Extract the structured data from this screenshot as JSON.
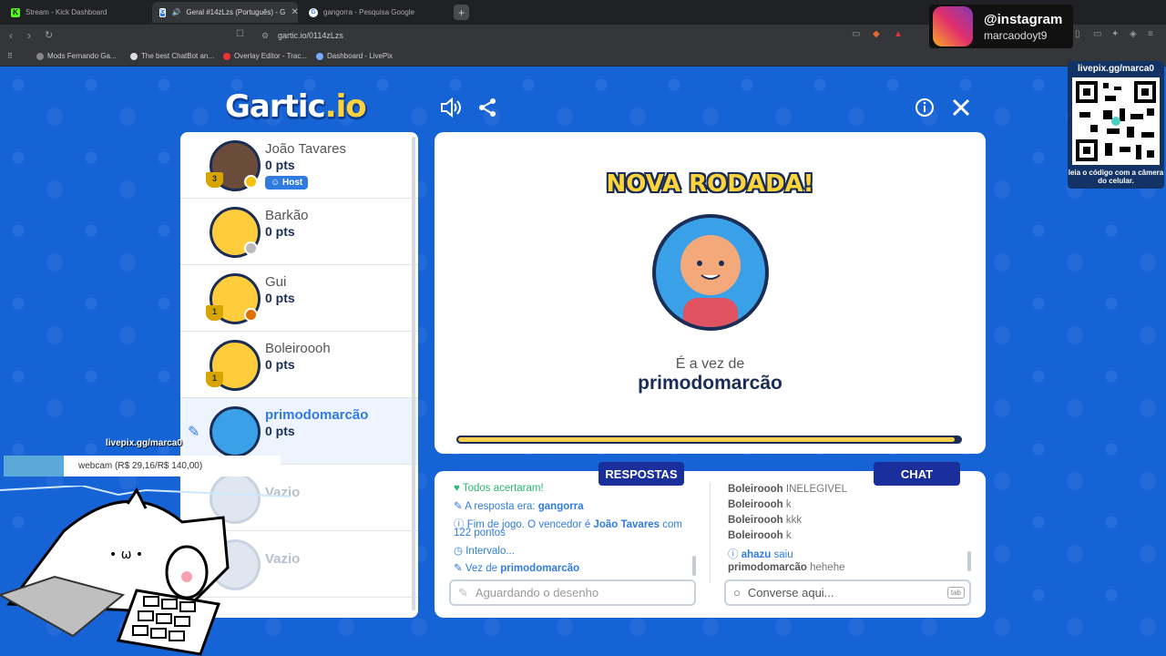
{
  "browser": {
    "tabs": [
      {
        "title": "Stream - Kick Dashboard"
      },
      {
        "title": "Geral #14zLzs (Português) - G"
      },
      {
        "title": "gangorra - Pesquisa Google"
      }
    ],
    "url": "gartic.io/0114zLzs",
    "bookmarks": [
      "Mods Fernando Ga...",
      "The best ChatBot an...",
      "Overlay Editor - Trac...",
      "Dashboard - LivePix"
    ]
  },
  "overlay": {
    "instagram_label": "@instagram",
    "instagram_user": "marcaodoyt9",
    "qr_title": "livepix.gg/marca0",
    "qr_caption": "leia o código com a câmera do celular.",
    "livepix_link": "livepix.gg/marca0",
    "webcam_goal": "webcam (R$ 29,16/R$ 140,00)"
  },
  "game": {
    "logo_a": "Gartic",
    "logo_b": ".io",
    "round_title": "NOVA RODADA!",
    "turn_label": "É a vez de",
    "turn_player": "primodomarcão",
    "timer_fraction": 0.99
  },
  "players": [
    {
      "name": "João Tavares",
      "points": "0 pts",
      "badge": "Host",
      "trophy": "3"
    },
    {
      "name": "Barkão",
      "points": "0 pts"
    },
    {
      "name": "Gui",
      "points": "0 pts",
      "trophy": "1"
    },
    {
      "name": "Boleiroooh",
      "points": "0 pts",
      "trophy": "1"
    },
    {
      "name": "primodomarcão",
      "points": "0 pts"
    },
    {
      "name": "Vazio"
    },
    {
      "name": "Vazio"
    }
  ],
  "answers": {
    "header": "RESPOSTAS",
    "messages": [
      {
        "text": "Todos acertaram!"
      },
      {
        "prefix": "A resposta era: ",
        "highlight": "gangorra"
      },
      {
        "prefix": "Fim de jogo. O vencedor é ",
        "highlight": "João Tavares",
        "suffix": " com",
        "line2": "122 pontos"
      },
      {
        "prefix": "Intervalo..."
      },
      {
        "prefix": "Vez de ",
        "highlight": "primodomarcão"
      }
    ],
    "input_placeholder": "Aguardando o desenho"
  },
  "chat": {
    "header": "CHAT",
    "messages": [
      {
        "user": "Boleiroooh",
        "text": "INELEGIVEL"
      },
      {
        "user": "Boleiroooh",
        "text": "k"
      },
      {
        "user": "Boleiroooh",
        "text": "kkk"
      },
      {
        "user": "Boleiroooh",
        "text": "k"
      },
      {
        "user": "ahazu",
        "text": "saiu"
      },
      {
        "user": "primodomarcão",
        "text": "hehehe"
      }
    ],
    "input_placeholder": "Converse aqui...",
    "tab_hint": "tab"
  },
  "colors": {
    "accent": "#1663d6",
    "navy": "#1a2e55",
    "gold": "#ffd43a"
  }
}
